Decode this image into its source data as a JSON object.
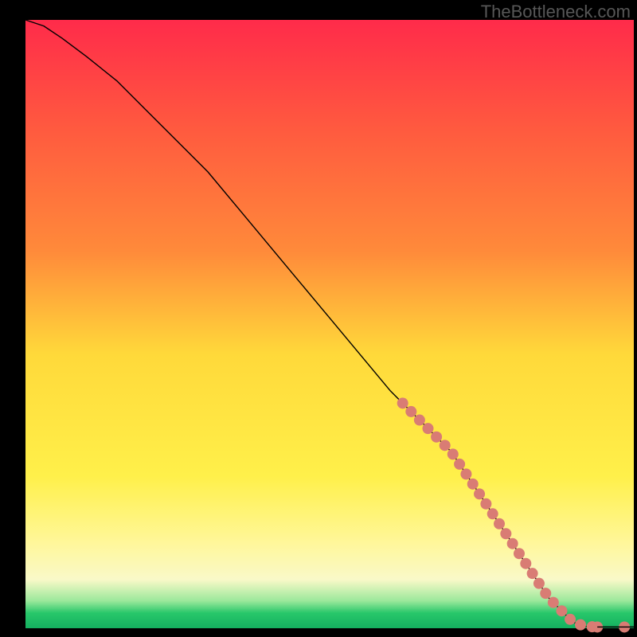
{
  "watermark": "TheBottleneck.com",
  "colors": {
    "black": "#000000",
    "line": "#000000",
    "dot_fill": "#d97c74",
    "dot_stroke": "#d97c74",
    "grad_top": "#ff2b4a",
    "grad_mid1": "#ff8a3a",
    "grad_mid2": "#ffd93a",
    "grad_mid3": "#fff79a",
    "grad_bottom_yellow": "#f9f9c8",
    "grad_green_light": "#9be89b",
    "grad_green": "#28c76a"
  },
  "chart_data": {
    "type": "line",
    "title": "",
    "xlabel": "",
    "ylabel": "",
    "xlim": [
      0,
      100
    ],
    "ylim": [
      0,
      100
    ],
    "x": [
      0,
      3,
      6,
      10,
      15,
      20,
      25,
      30,
      35,
      40,
      45,
      50,
      55,
      60,
      62,
      64,
      66,
      68,
      70,
      72,
      74,
      76,
      78,
      80,
      82,
      84,
      86,
      88,
      90,
      92,
      94,
      96,
      98,
      100
    ],
    "values": [
      100,
      99,
      97,
      94,
      90,
      85,
      80,
      75,
      69,
      63,
      57,
      51,
      45,
      39,
      37,
      35,
      33,
      31,
      29,
      26,
      23,
      20,
      17,
      14,
      11,
      8,
      5,
      3,
      1,
      0.3,
      0.2,
      0.2,
      0.2,
      0.2
    ],
    "dashed_segments": [
      {
        "start_index": 14,
        "end_index": 30
      },
      {
        "start_index": 30,
        "end_index": 33
      }
    ],
    "dash_radius": 1.1,
    "curve_notes": "Monotone decreasing curve from top-left to bottom-right; slight shoulder near x=0-8 then near-linear descent; flattens to ~0 at x≈90 and stays flat to x=100. Dashed (dotted salmon) overlay begins around x≈62 down to the flat tail."
  }
}
